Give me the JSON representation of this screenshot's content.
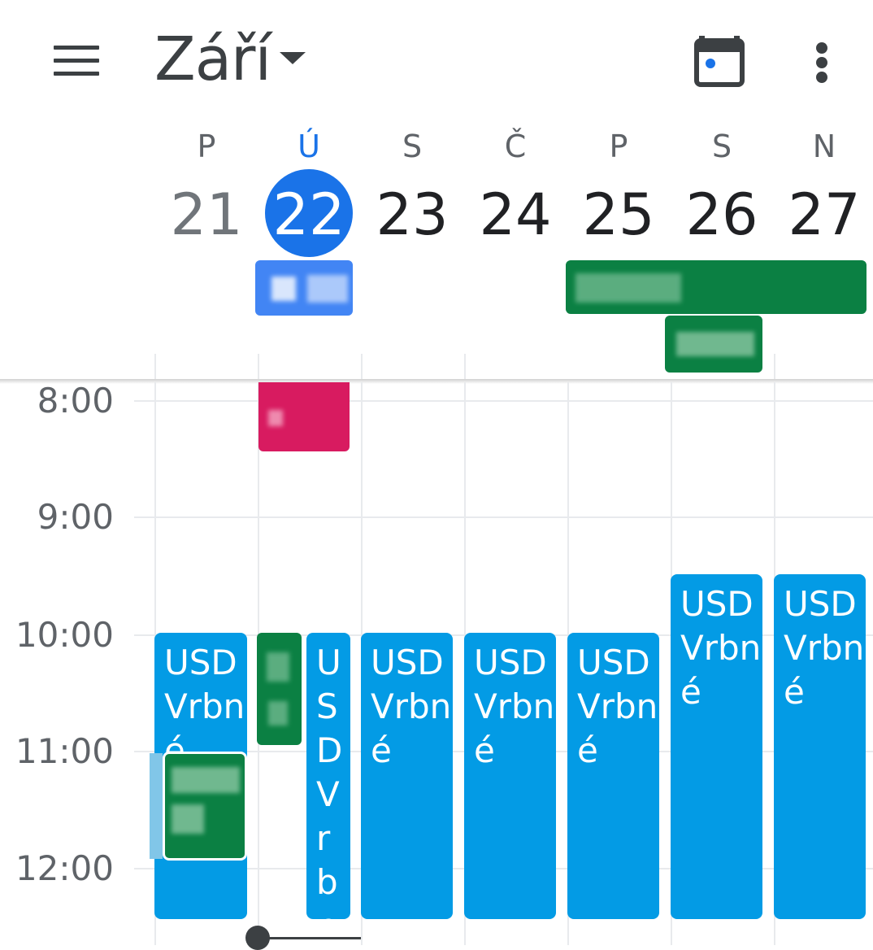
{
  "header": {
    "month": "Září",
    "icons": {
      "menu": "menu-icon",
      "dropdown": "caret-down-icon",
      "today": "calendar-today-icon",
      "more": "more-vert-icon"
    },
    "colors": {
      "accent": "#1a73e8",
      "text": "#3c4043"
    }
  },
  "days": [
    {
      "dow": "P",
      "num": "21"
    },
    {
      "dow": "Ú",
      "num": "22"
    },
    {
      "dow": "S",
      "num": "23"
    },
    {
      "dow": "Č",
      "num": "24"
    },
    {
      "dow": "P",
      "num": "25"
    },
    {
      "dow": "S",
      "num": "26"
    },
    {
      "dow": "N",
      "num": "27"
    }
  ],
  "times": [
    "8:00",
    "9:00",
    "10:00",
    "11:00",
    "12:00"
  ],
  "events": {
    "usd": "USD Vrbné"
  },
  "event_colors": {
    "blue": "#039be5",
    "green": "#0b8043",
    "pink": "#d81b60",
    "allday_blue": "#4285f4"
  }
}
